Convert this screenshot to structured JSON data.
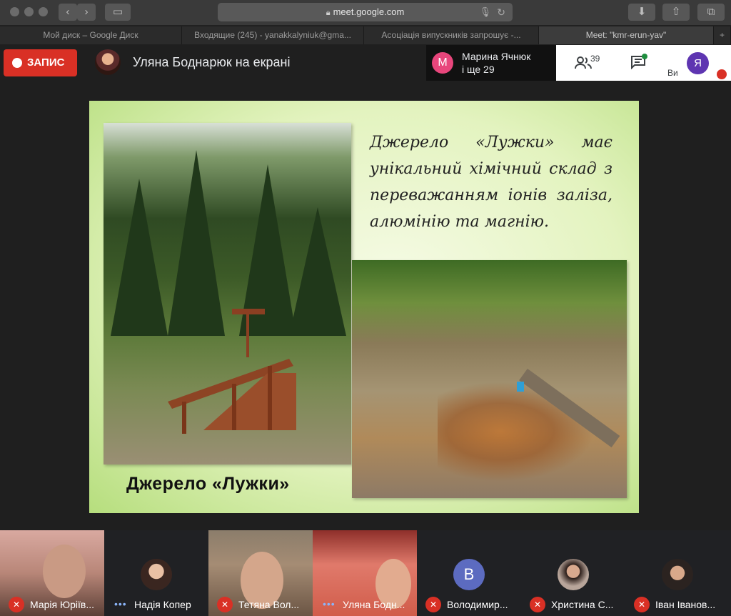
{
  "browser": {
    "url": "meet.google.com",
    "tabs": [
      {
        "label": "Мой диск – Google Диск",
        "active": false
      },
      {
        "label": "Входящие (245) - yanakkalyniuk@gma...",
        "active": false
      },
      {
        "label": "Асоціація випускників запрошує -...",
        "active": false
      },
      {
        "label": "Meet: \"kmr-erun-yav\"",
        "active": true
      }
    ]
  },
  "header": {
    "record_label": "ЗАПИС",
    "presenting_text": "Уляна Боднарюк на екрані",
    "notification": {
      "avatar_letter": "М",
      "line1": "Марина Ячнюк",
      "line2": "і ще 29"
    },
    "participants_count": "39",
    "me_label": "Ви",
    "me_avatar_letter": "Я"
  },
  "slide": {
    "text": "Джерело «Лужки» має унікальний хімічний склад з переважанням іонів заліза, алюмінію та магнію.",
    "caption": "Джерело «Лужки»"
  },
  "participants": [
    {
      "name": "Марія Юріїв...",
      "muted": true,
      "type": "video"
    },
    {
      "name": "Надія Копер",
      "muted": false,
      "type": "avatar"
    },
    {
      "name": "Тетяна Вол...",
      "muted": true,
      "type": "video"
    },
    {
      "name": "Уляна Бодн...",
      "muted": false,
      "type": "video"
    },
    {
      "name": "Володимир...",
      "muted": true,
      "type": "letter",
      "letter": "В"
    },
    {
      "name": "Христина С...",
      "muted": true,
      "type": "avatar"
    },
    {
      "name": "Іван Іванов...",
      "muted": true,
      "type": "avatar"
    }
  ],
  "colors": {
    "record": "#d93025",
    "notif_avatar": "#e8467c",
    "me_avatar": "#5e35b1",
    "letter_avatar": "#5c6bc0"
  }
}
